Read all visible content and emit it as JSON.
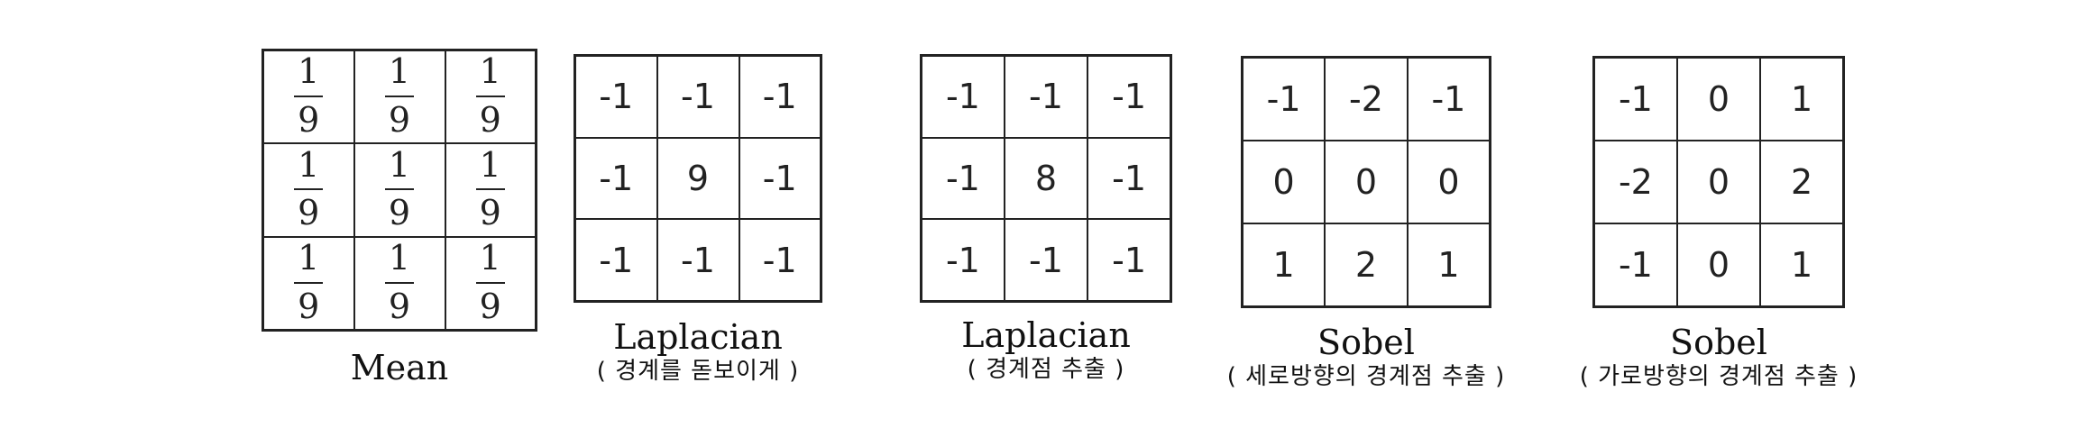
{
  "kernels": [
    {
      "name": "Mean",
      "subtitle": "",
      "rows": [
        [
          {
            "num": "1",
            "den": "9"
          },
          {
            "num": "1",
            "den": "9"
          },
          {
            "num": "1",
            "den": "9"
          }
        ],
        [
          {
            "num": "1",
            "den": "9"
          },
          {
            "num": "1",
            "den": "9"
          },
          {
            "num": "1",
            "den": "9"
          }
        ],
        [
          {
            "num": "1",
            "den": "9"
          },
          {
            "num": "1",
            "den": "9"
          },
          {
            "num": "1",
            "den": "9"
          }
        ]
      ]
    },
    {
      "name": "Laplacian",
      "subtitle": "( 경계를 돋보이게 )",
      "rows": [
        [
          "-1",
          "-1",
          "-1"
        ],
        [
          "-1",
          "9",
          "-1"
        ],
        [
          "-1",
          "-1",
          "-1"
        ]
      ]
    },
    {
      "name": "Laplacian",
      "subtitle": "( 경계점 추출 )",
      "rows": [
        [
          "-1",
          "-1",
          "-1"
        ],
        [
          "-1",
          "8",
          "-1"
        ],
        [
          "-1",
          "-1",
          "-1"
        ]
      ]
    },
    {
      "name": "Sobel",
      "subtitle": "( 세로방향의 경계점 추출 )",
      "rows": [
        [
          "-1",
          "-2",
          "-1"
        ],
        [
          "0",
          "0",
          "0"
        ],
        [
          "1",
          "2",
          "1"
        ]
      ]
    },
    {
      "name": "Sobel",
      "subtitle": "( 가로방향의 경계점 추출 )",
      "rows": [
        [
          "-1",
          "0",
          "1"
        ],
        [
          "-2",
          "0",
          "2"
        ],
        [
          "-1",
          "0",
          "1"
        ]
      ]
    }
  ]
}
